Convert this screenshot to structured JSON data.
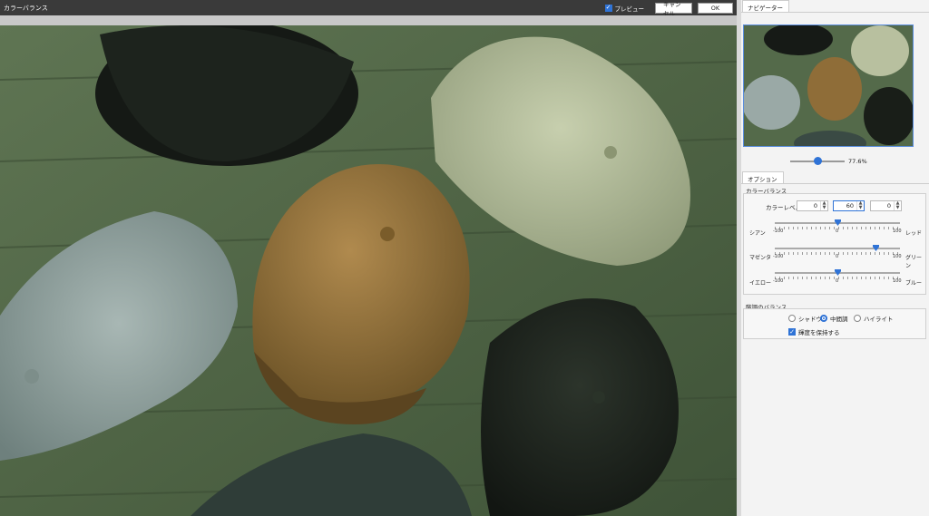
{
  "window": {
    "title": "カラーバランス",
    "preview_label": "プレビュー",
    "preview_checked": true,
    "cancel_label": "キャンセル",
    "ok_label": "OK"
  },
  "navigator": {
    "tab": "ナビゲーター",
    "zoom": "77.6%"
  },
  "options": {
    "tab": "オプション",
    "color_balance": {
      "group_label": "カラーバランス",
      "level_label": "カラーレベル",
      "levels": [
        "0",
        "60",
        "0"
      ],
      "sliders": [
        {
          "left": "シアン",
          "right": "レッド",
          "value": 0,
          "min": "-100",
          "mid": "0",
          "max": "100"
        },
        {
          "left": "マゼンタ",
          "right": "グリーン",
          "value": 60,
          "min": "-100",
          "mid": "0",
          "max": "100"
        },
        {
          "left": "イエロー",
          "right": "ブルー",
          "value": 0,
          "min": "-100",
          "mid": "0",
          "max": "100"
        }
      ]
    },
    "tone_balance": {
      "group_label": "階調のバランス",
      "shadow": "シャドウ",
      "midtone": "中間調",
      "highlight": "ハイライト",
      "selected": "中間調",
      "preserve_label": "輝度を保持する",
      "preserve_checked": true
    }
  },
  "colors": {
    "accent": "#2f73d6",
    "titlebar": "#3a3a3a",
    "wood": "#556b4a"
  }
}
